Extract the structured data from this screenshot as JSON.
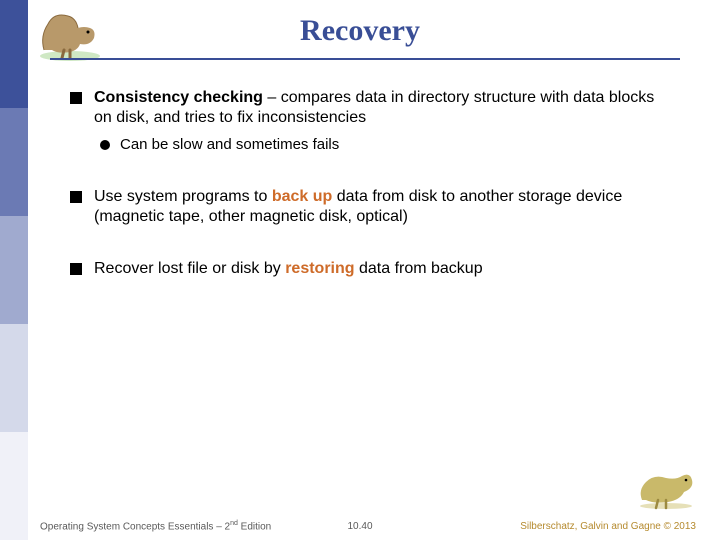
{
  "title": "Recovery",
  "bullets": {
    "b1_bold": "Consistency checking",
    "b1_rest": " – compares data in directory structure with data blocks on disk, and tries to fix inconsistencies",
    "b1_sub": "Can be slow and sometimes fails",
    "b2_pre": "Use system programs to ",
    "b2_accent": "back up",
    "b2_post": " data from disk to another storage device (magnetic tape, other magnetic disk, optical)",
    "b3_pre": "Recover lost file or disk by ",
    "b3_accent": "restoring",
    "b3_post": " data from backup"
  },
  "footer": {
    "left_a": "Operating System Concepts Essentials – 2",
    "left_sup": "nd",
    "left_b": " Edition",
    "center": "10.40",
    "right": "Silberschatz, Galvin and Gagne © 2013"
  }
}
